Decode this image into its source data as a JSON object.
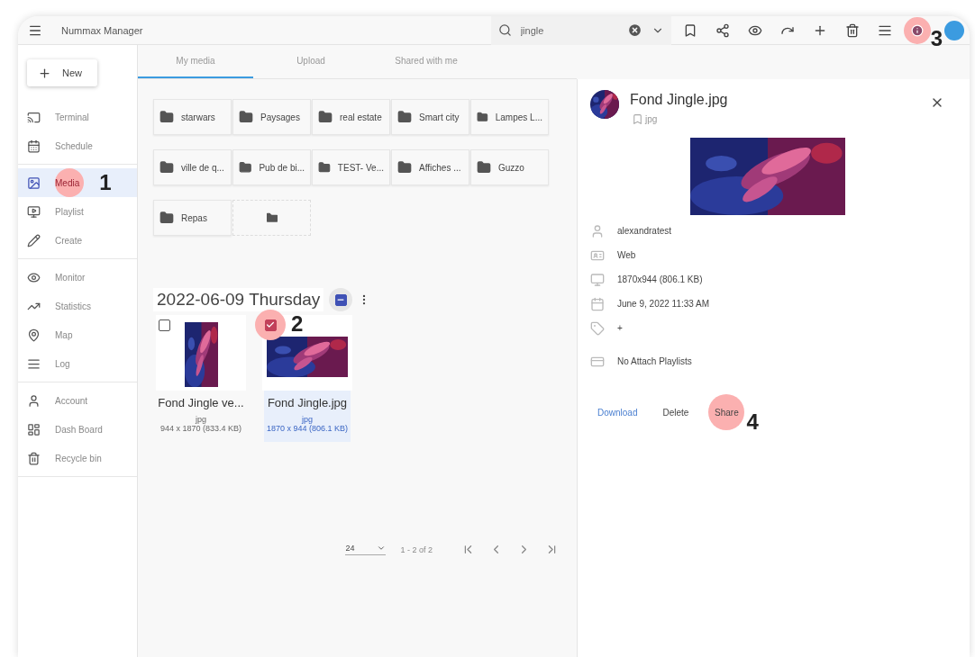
{
  "app": {
    "title": "Nummax Manager"
  },
  "search": {
    "value": "jingle"
  },
  "toolbar": {
    "info_callout": "3"
  },
  "new_button": {
    "label": "New"
  },
  "sidebar": {
    "groups": [
      {
        "items": [
          {
            "label": "Terminal",
            "selected": false
          },
          {
            "label": "Schedule",
            "selected": false
          }
        ]
      },
      {
        "items": [
          {
            "label": "Media",
            "selected": true,
            "callout": "1"
          },
          {
            "label": "Playlist",
            "selected": false
          },
          {
            "label": "Create",
            "selected": false
          }
        ]
      },
      {
        "items": [
          {
            "label": "Monitor",
            "selected": false
          },
          {
            "label": "Statistics",
            "selected": false
          },
          {
            "label": "Map",
            "selected": false
          },
          {
            "label": "Log",
            "selected": false
          }
        ]
      },
      {
        "items": [
          {
            "label": "Account",
            "selected": false
          },
          {
            "label": "Dash Board",
            "selected": false
          },
          {
            "label": "Recycle bin",
            "selected": false
          }
        ]
      }
    ]
  },
  "tabs": [
    {
      "label": "My media",
      "selected": true
    },
    {
      "label": "Upload",
      "selected": false
    },
    {
      "label": "Shared with me",
      "selected": false
    }
  ],
  "folders": [
    "starwars",
    "Paysages",
    "real estate",
    "Smart city",
    "Lampes L...",
    "ville de q...",
    "Pub de bi...",
    "TEST- Ve...",
    "Affiches ...",
    "Guzzo",
    "Repas"
  ],
  "date_group": {
    "title": "2022-06-09 Thursday",
    "checked": true,
    "indeterminate": true,
    "items": [
      {
        "name": "Fond Jingle ve...",
        "type": "jpg",
        "size": "944 x 1870 (833.4 KB)",
        "selected": false
      },
      {
        "name": "Fond Jingle.jpg",
        "type": "jpg",
        "size": "1870 x 944 (806.1 KB)",
        "selected": true,
        "callout": "2"
      }
    ]
  },
  "pagination": {
    "page_size": "24",
    "range": "1 - 2 of 2"
  },
  "details": {
    "title": "Fond Jingle.jpg",
    "type": "jpg",
    "rows": [
      "alexandratest",
      "Web",
      "1870x944 (806.1 KB)",
      "June 9, 2022 11:33 AM",
      "+",
      "No Attach Playlists"
    ],
    "actions": [
      {
        "label": "Download",
        "kind": "primary"
      },
      {
        "label": "Delete",
        "kind": "plain"
      },
      {
        "label": "Share",
        "kind": "plain",
        "callout": "4"
      }
    ]
  }
}
